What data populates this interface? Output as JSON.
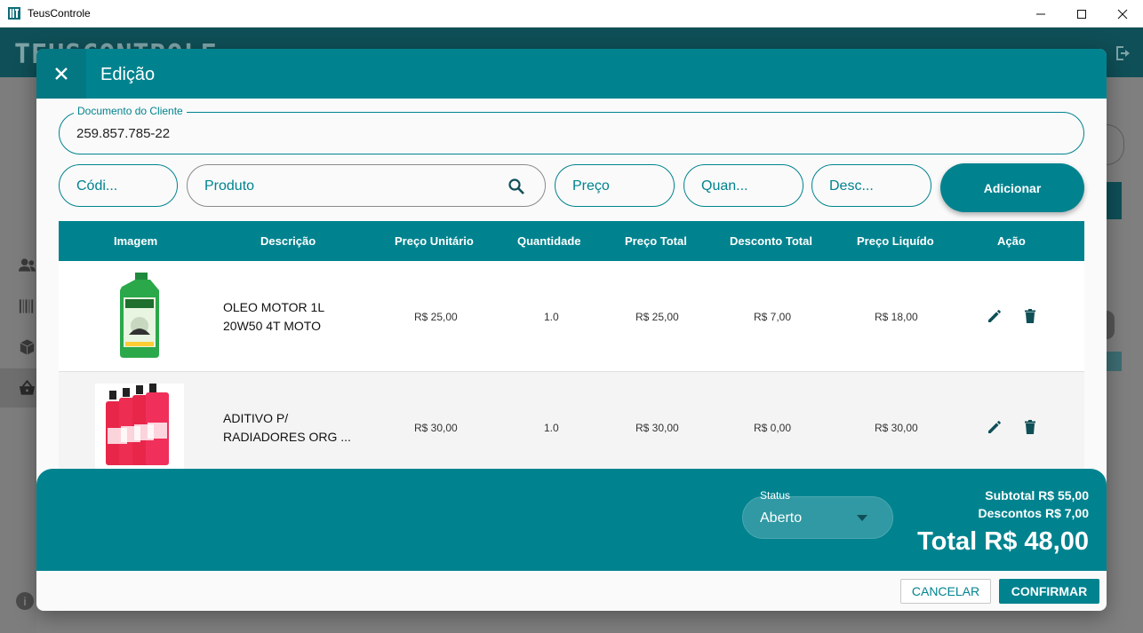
{
  "window": {
    "title": "TeusControle",
    "icons": {
      "app": "app-logo-icon",
      "minimize": "minimize-icon",
      "maximize": "maximize-icon",
      "close": "close-icon"
    }
  },
  "background": {
    "logo_text": "TEUSCONTROLE",
    "info_glyph": "i",
    "icons": [
      "users-icon",
      "barcode-icon",
      "box-icon",
      "basket-icon",
      "logout-icon",
      "info-icon"
    ]
  },
  "dialog": {
    "title": "Edição",
    "close_icon": "close-icon",
    "document_field": {
      "label": "Documento do Cliente",
      "value": "259.857.785-22"
    },
    "inputs": {
      "codigo": "Códi...",
      "produto": "Produto",
      "preco": "Preço",
      "quantidade": "Quan...",
      "desconto": "Desc..."
    },
    "add_button": "Adicionar",
    "table": {
      "headers": [
        "Imagem",
        "Descrição",
        "Preço Unitário",
        "Quantidade",
        "Preço Total",
        "Desconto Total",
        "Preço Liquído",
        "Ação"
      ],
      "rows": [
        {
          "image": "oil-bottle-image",
          "description": [
            "OLEO MOTOR 1L",
            "20W50 4T MOTO"
          ],
          "unit_price": "R$ 25,00",
          "quantity": "1.0",
          "total_price": "R$ 25,00",
          "discount": "R$ 7,00",
          "net_price": "R$ 18,00"
        },
        {
          "image": "radiator-additive-image",
          "description": [
            "ADITIVO P/",
            "RADIADORES ORG ..."
          ],
          "unit_price": "R$ 30,00",
          "quantity": "1.0",
          "total_price": "R$ 30,00",
          "discount": "R$ 0,00",
          "net_price": "R$ 30,00"
        }
      ]
    },
    "status": {
      "label": "Status",
      "value": "Aberto"
    },
    "totals": {
      "subtotal": "Subtotal R$ 55,00",
      "descontos": "Descontos R$ 7,00",
      "total": "Total R$ 48,00"
    },
    "buttons": {
      "cancel": "CANCELAR",
      "confirm": "CONFIRMAR"
    }
  },
  "colors": {
    "primary": "#00838f",
    "dark_header": "#0f4f57",
    "action_icon": "#0f4f57"
  }
}
